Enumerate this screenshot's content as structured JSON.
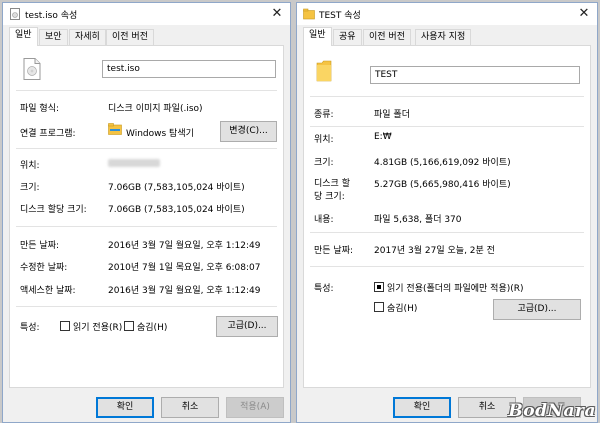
{
  "left": {
    "title": "test.iso 속성",
    "tabs": [
      "일반",
      "보안",
      "자세히",
      "이전 버전"
    ],
    "filename": "test.iso",
    "rows": {
      "type_label": "파일 형식:",
      "type_value": "디스크 이미지 파일(.iso)",
      "opens_label": "연결 프로그램:",
      "opens_value": "Windows 탐색기",
      "change_btn": "변경(C)...",
      "location_label": "위치:",
      "size_label": "크기:",
      "size_value": "7.06GB (7,583,105,024 바이트)",
      "disk_label": "디스크 할당 크기:",
      "disk_value": "7.06GB (7,583,105,024 바이트)",
      "created_label": "만든 날짜:",
      "created_value": "2016년 3월 7일 월요일, 오후 1:12:49",
      "modified_label": "수정한 날짜:",
      "modified_value": "2010년 7월 1일 목요일, 오후 6:08:07",
      "accessed_label": "액세스한 날짜:",
      "accessed_value": "2016년 3월 7일 월요일, 오후 1:12:49",
      "attr_label": "특성:",
      "readonly_label": "읽기 전용(R)",
      "hidden_label": "숨김(H)",
      "advanced_btn": "고급(D)..."
    },
    "buttons": {
      "ok": "확인",
      "cancel": "취소",
      "apply": "적용(A)"
    }
  },
  "right": {
    "title": "TEST 속성",
    "tabs": [
      "일반",
      "공유",
      "이전 버전",
      "사용자 지정"
    ],
    "foldername": "TEST",
    "rows": {
      "type_label": "종류:",
      "type_value": "파일 폴더",
      "location_label": "위치:",
      "location_value": "E:₩",
      "size_label": "크기:",
      "size_value": "4.81GB (5,166,619,092 바이트)",
      "disk_label_1": "디스크 할",
      "disk_label_2": "당 크기:",
      "disk_value": "5.27GB (5,665,980,416 바이트)",
      "contents_label": "내용:",
      "contents_value": "파일 5,638, 폴더 370",
      "created_label": "만든 날짜:",
      "created_value": "2017년 3월 27일 오늘, 2분 전",
      "attr_label": "특성:",
      "readonly_label": "읽기 전용(폴더의 파일에만 적용)(R)",
      "hidden_label": "숨김(H)",
      "advanced_btn": "고급(D)..."
    },
    "buttons": {
      "ok": "확인",
      "cancel": "취소"
    }
  },
  "watermark": "BodNara",
  "colors": {
    "folder": "#f5c342",
    "accent": "#0078d7",
    "titlebar": "#ffffff"
  }
}
